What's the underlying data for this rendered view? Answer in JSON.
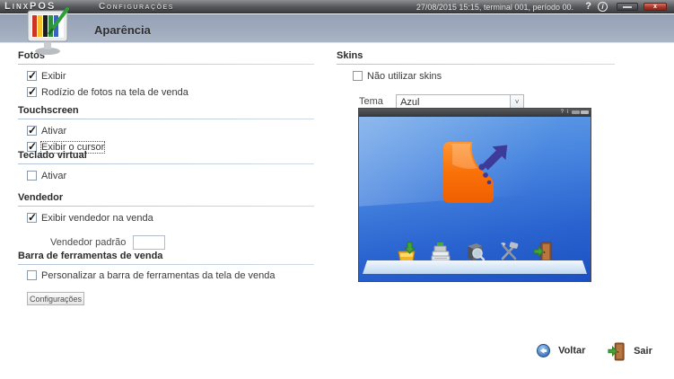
{
  "topbar": {
    "logo": "LinxPOS",
    "title": "Configurações",
    "status": "27/08/2015 15:15, terminal 001, período 00.",
    "help_glyph": "?",
    "info_glyph": "i",
    "close_glyph": "x"
  },
  "header": {
    "title": "Aparência"
  },
  "left": {
    "fotos": {
      "title": "Fotos",
      "exibir": {
        "label": "Exibir",
        "checked": true
      },
      "rodizio": {
        "label": "Rodízio de fotos na tela de venda",
        "checked": true
      }
    },
    "touchscreen": {
      "title": "Touchscreen",
      "ativar": {
        "label": "Ativar",
        "checked": true
      },
      "cursor": {
        "label": "Exibir o cursor",
        "checked": true,
        "focused": true
      }
    },
    "teclado": {
      "title": "Teclado virtual",
      "ativar": {
        "label": "Ativar",
        "checked": false
      }
    },
    "vendedor": {
      "title": "Vendedor",
      "exibir": {
        "label": "Exibir vendedor na venda",
        "checked": true
      },
      "padrao_label": "Vendedor padrão",
      "padrao_value": ""
    },
    "barra": {
      "title": "Barra de ferramentas de venda",
      "personalizar": {
        "label": "Personalizar a barra de ferramentas da tela de venda",
        "checked": false
      },
      "config_button": "Configurações"
    }
  },
  "skins": {
    "title": "Skins",
    "nao_utilizar": {
      "label": "Não utilizar skins",
      "checked": false
    },
    "tema_label": "Tema",
    "tema_value": "Azul",
    "preview_titlebar_icons": "? i"
  },
  "footer": {
    "voltar": "Voltar",
    "sair": "Sair"
  },
  "colors": {
    "accent_orange": "#f97108",
    "accent_indigo": "#3d3a99",
    "preview_blue_top": "#6aa3e8",
    "preview_blue_bottom": "#1c50c2",
    "band_bluegray": "#9aa6b8",
    "close_red": "#a23327"
  }
}
